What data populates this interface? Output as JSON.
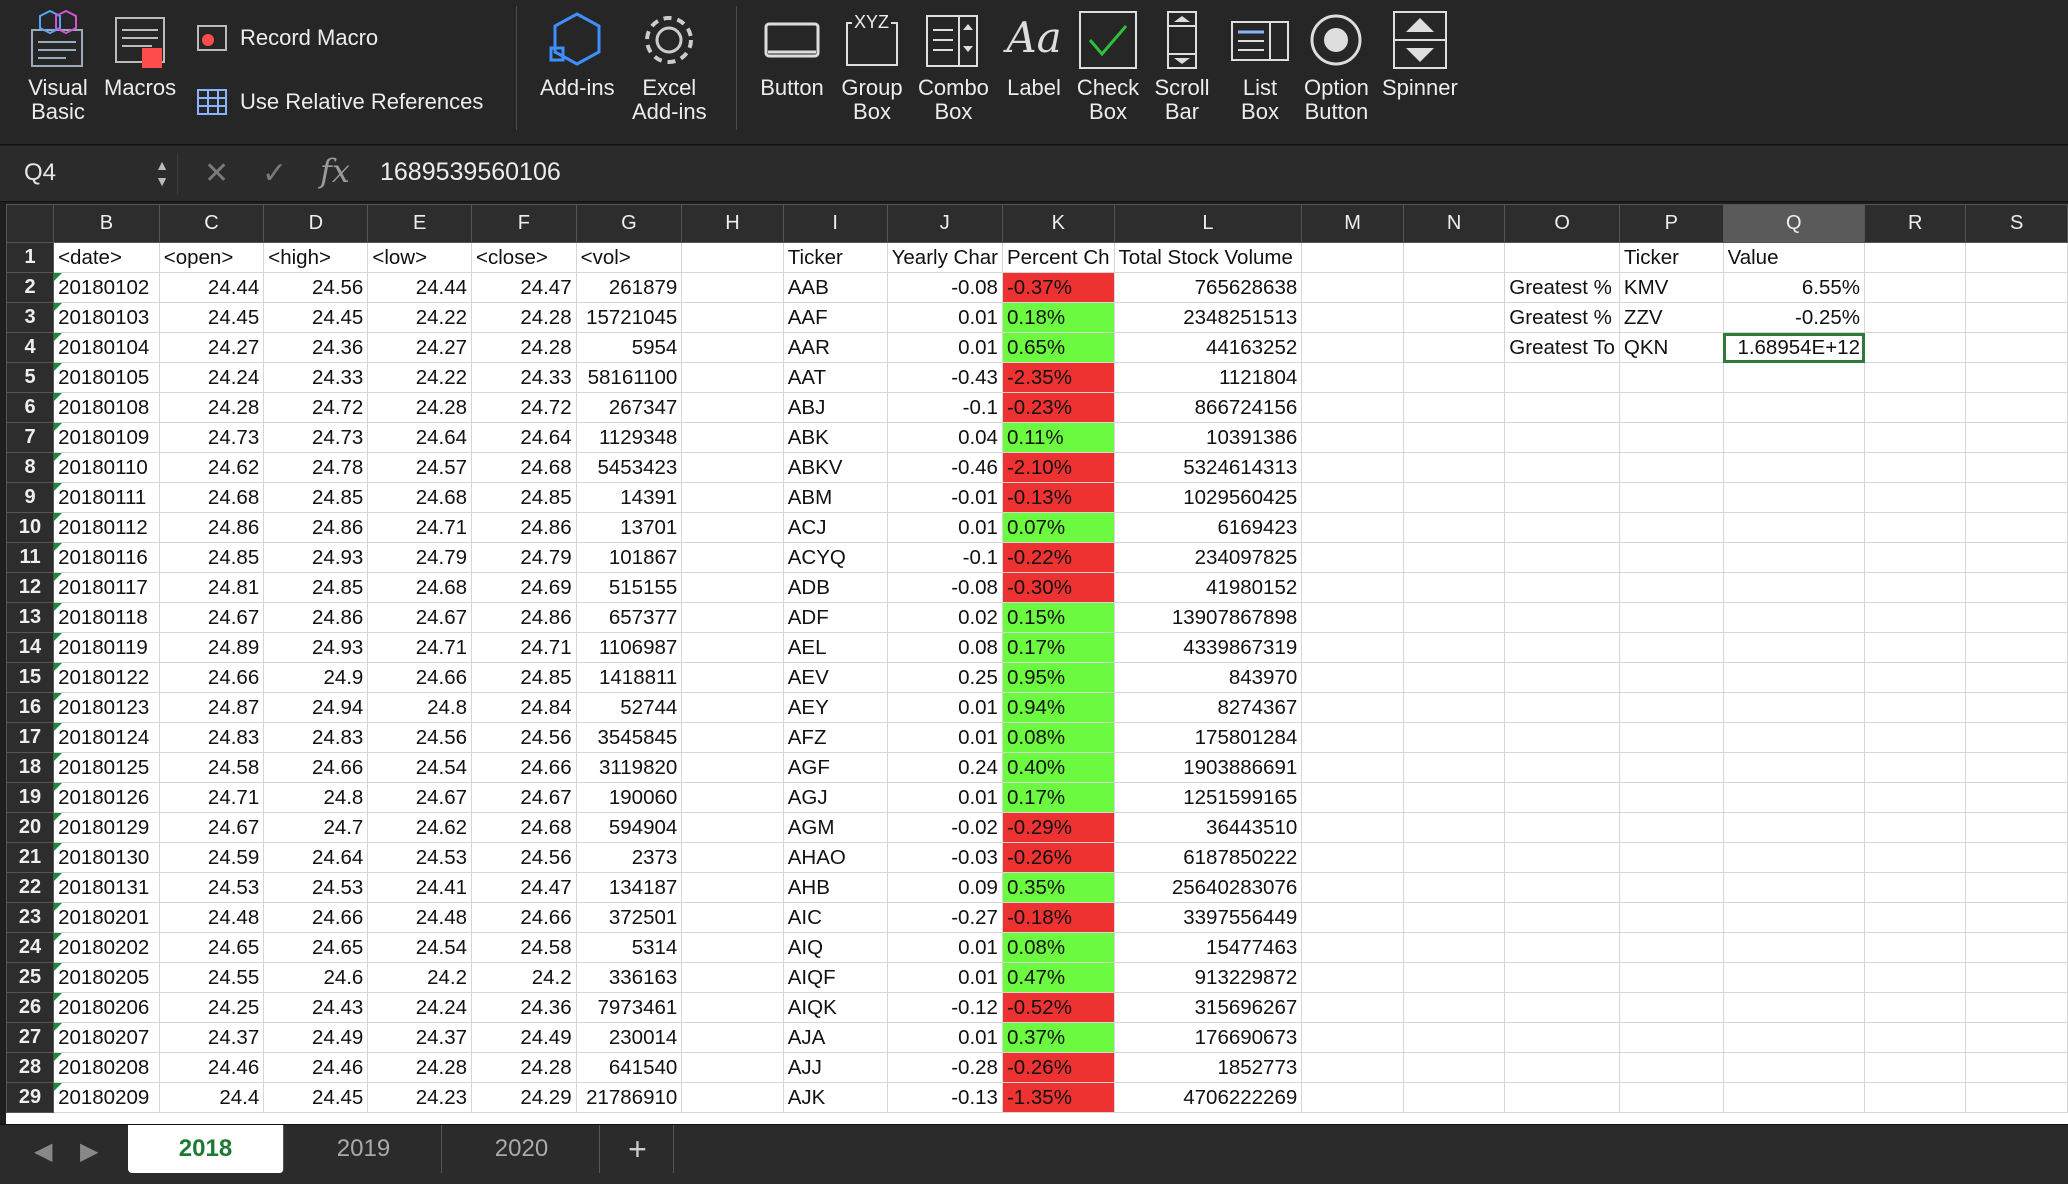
{
  "ribbon": {
    "visual_basic": "Visual\nBasic",
    "macros": "Macros",
    "record_macro": "Record Macro",
    "use_relative_references": "Use Relative References",
    "add_ins": "Add-ins",
    "excel_add_ins": "Excel\nAdd-ins",
    "button": "Button",
    "group_box": "Group\nBox",
    "combo_box": "Combo\nBox",
    "label": "Label",
    "check_box": "Check\nBox",
    "scroll_bar": "Scroll\nBar",
    "list_box": "List\nBox",
    "option_button": "Option\nButton",
    "spinner": "Spinner",
    "label_icon_text": "Aa",
    "group_box_icon_text": "XYZ"
  },
  "formula_bar": {
    "name_box": "Q4",
    "fx": "fx",
    "value": "1689539560106"
  },
  "columns": [
    "B",
    "C",
    "D",
    "E",
    "F",
    "G",
    "H",
    "I",
    "J",
    "K",
    "L",
    "M",
    "N",
    "O",
    "P",
    "Q",
    "R",
    "S"
  ],
  "header_row": [
    "<date>",
    "<open>",
    "<high>",
    "<low>",
    "<close>",
    "<vol>",
    "",
    "Ticker",
    "Yearly Char",
    "Percent Ch",
    "Total Stock Volume",
    "",
    "",
    "",
    "Ticker",
    "Value",
    "",
    ""
  ],
  "rows": [
    {
      "n": "2",
      "date": "20180102",
      "open": "24.44",
      "high": "24.56",
      "low": "24.44",
      "close": "24.47",
      "vol": "261879",
      "ticker": "AAB",
      "yc": "-0.08",
      "pct": "-0.37%",
      "tv": "765628638",
      "o": "Greatest %",
      "p": "KMV",
      "q": "6.55%"
    },
    {
      "n": "3",
      "date": "20180103",
      "open": "24.45",
      "high": "24.45",
      "low": "24.22",
      "close": "24.28",
      "vol": "15721045",
      "ticker": "AAF",
      "yc": "0.01",
      "pct": "0.18%",
      "tv": "2348251513",
      "o": "Greatest %",
      "p": "ZZV",
      "q": "-0.25%"
    },
    {
      "n": "4",
      "date": "20180104",
      "open": "24.27",
      "high": "24.36",
      "low": "24.27",
      "close": "24.28",
      "vol": "5954",
      "ticker": "AAR",
      "yc": "0.01",
      "pct": "0.65%",
      "tv": "44163252",
      "o": "Greatest To",
      "p": "QKN",
      "q": "1.68954E+12"
    },
    {
      "n": "5",
      "date": "20180105",
      "open": "24.24",
      "high": "24.33",
      "low": "24.22",
      "close": "24.33",
      "vol": "58161100",
      "ticker": "AAT",
      "yc": "-0.43",
      "pct": "-2.35%",
      "tv": "1121804",
      "o": "",
      "p": "",
      "q": ""
    },
    {
      "n": "6",
      "date": "20180108",
      "open": "24.28",
      "high": "24.72",
      "low": "24.28",
      "close": "24.72",
      "vol": "267347",
      "ticker": "ABJ",
      "yc": "-0.1",
      "pct": "-0.23%",
      "tv": "866724156",
      "o": "",
      "p": "",
      "q": ""
    },
    {
      "n": "7",
      "date": "20180109",
      "open": "24.73",
      "high": "24.73",
      "low": "24.64",
      "close": "24.64",
      "vol": "1129348",
      "ticker": "ABK",
      "yc": "0.04",
      "pct": "0.11%",
      "tv": "10391386",
      "o": "",
      "p": "",
      "q": ""
    },
    {
      "n": "8",
      "date": "20180110",
      "open": "24.62",
      "high": "24.78",
      "low": "24.57",
      "close": "24.68",
      "vol": "5453423",
      "ticker": "ABKV",
      "yc": "-0.46",
      "pct": "-2.10%",
      "tv": "5324614313",
      "o": "",
      "p": "",
      "q": ""
    },
    {
      "n": "9",
      "date": "20180111",
      "open": "24.68",
      "high": "24.85",
      "low": "24.68",
      "close": "24.85",
      "vol": "14391",
      "ticker": "ABM",
      "yc": "-0.01",
      "pct": "-0.13%",
      "tv": "1029560425",
      "o": "",
      "p": "",
      "q": ""
    },
    {
      "n": "10",
      "date": "20180112",
      "open": "24.86",
      "high": "24.86",
      "low": "24.71",
      "close": "24.86",
      "vol": "13701",
      "ticker": "ACJ",
      "yc": "0.01",
      "pct": "0.07%",
      "tv": "6169423",
      "o": "",
      "p": "",
      "q": ""
    },
    {
      "n": "11",
      "date": "20180116",
      "open": "24.85",
      "high": "24.93",
      "low": "24.79",
      "close": "24.79",
      "vol": "101867",
      "ticker": "ACYQ",
      "yc": "-0.1",
      "pct": "-0.22%",
      "tv": "234097825",
      "o": "",
      "p": "",
      "q": ""
    },
    {
      "n": "12",
      "date": "20180117",
      "open": "24.81",
      "high": "24.85",
      "low": "24.68",
      "close": "24.69",
      "vol": "515155",
      "ticker": "ADB",
      "yc": "-0.08",
      "pct": "-0.30%",
      "tv": "41980152",
      "o": "",
      "p": "",
      "q": ""
    },
    {
      "n": "13",
      "date": "20180118",
      "open": "24.67",
      "high": "24.86",
      "low": "24.67",
      "close": "24.86",
      "vol": "657377",
      "ticker": "ADF",
      "yc": "0.02",
      "pct": "0.15%",
      "tv": "13907867898",
      "o": "",
      "p": "",
      "q": ""
    },
    {
      "n": "14",
      "date": "20180119",
      "open": "24.89",
      "high": "24.93",
      "low": "24.71",
      "close": "24.71",
      "vol": "1106987",
      "ticker": "AEL",
      "yc": "0.08",
      "pct": "0.17%",
      "tv": "4339867319",
      "o": "",
      "p": "",
      "q": ""
    },
    {
      "n": "15",
      "date": "20180122",
      "open": "24.66",
      "high": "24.9",
      "low": "24.66",
      "close": "24.85",
      "vol": "1418811",
      "ticker": "AEV",
      "yc": "0.25",
      "pct": "0.95%",
      "tv": "843970",
      "o": "",
      "p": "",
      "q": ""
    },
    {
      "n": "16",
      "date": "20180123",
      "open": "24.87",
      "high": "24.94",
      "low": "24.8",
      "close": "24.84",
      "vol": "52744",
      "ticker": "AEY",
      "yc": "0.01",
      "pct": "0.94%",
      "tv": "8274367",
      "o": "",
      "p": "",
      "q": ""
    },
    {
      "n": "17",
      "date": "20180124",
      "open": "24.83",
      "high": "24.83",
      "low": "24.56",
      "close": "24.56",
      "vol": "3545845",
      "ticker": "AFZ",
      "yc": "0.01",
      "pct": "0.08%",
      "tv": "175801284",
      "o": "",
      "p": "",
      "q": ""
    },
    {
      "n": "18",
      "date": "20180125",
      "open": "24.58",
      "high": "24.66",
      "low": "24.54",
      "close": "24.66",
      "vol": "3119820",
      "ticker": "AGF",
      "yc": "0.24",
      "pct": "0.40%",
      "tv": "1903886691",
      "o": "",
      "p": "",
      "q": ""
    },
    {
      "n": "19",
      "date": "20180126",
      "open": "24.71",
      "high": "24.8",
      "low": "24.67",
      "close": "24.67",
      "vol": "190060",
      "ticker": "AGJ",
      "yc": "0.01",
      "pct": "0.17%",
      "tv": "1251599165",
      "o": "",
      "p": "",
      "q": ""
    },
    {
      "n": "20",
      "date": "20180129",
      "open": "24.67",
      "high": "24.7",
      "low": "24.62",
      "close": "24.68",
      "vol": "594904",
      "ticker": "AGM",
      "yc": "-0.02",
      "pct": "-0.29%",
      "tv": "36443510",
      "o": "",
      "p": "",
      "q": ""
    },
    {
      "n": "21",
      "date": "20180130",
      "open": "24.59",
      "high": "24.64",
      "low": "24.53",
      "close": "24.56",
      "vol": "2373",
      "ticker": "AHAO",
      "yc": "-0.03",
      "pct": "-0.26%",
      "tv": "6187850222",
      "o": "",
      "p": "",
      "q": ""
    },
    {
      "n": "22",
      "date": "20180131",
      "open": "24.53",
      "high": "24.53",
      "low": "24.41",
      "close": "24.47",
      "vol": "134187",
      "ticker": "AHB",
      "yc": "0.09",
      "pct": "0.35%",
      "tv": "25640283076",
      "o": "",
      "p": "",
      "q": ""
    },
    {
      "n": "23",
      "date": "20180201",
      "open": "24.48",
      "high": "24.66",
      "low": "24.48",
      "close": "24.66",
      "vol": "372501",
      "ticker": "AIC",
      "yc": "-0.27",
      "pct": "-0.18%",
      "tv": "3397556449",
      "o": "",
      "p": "",
      "q": ""
    },
    {
      "n": "24",
      "date": "20180202",
      "open": "24.65",
      "high": "24.65",
      "low": "24.54",
      "close": "24.58",
      "vol": "5314",
      "ticker": "AIQ",
      "yc": "0.01",
      "pct": "0.08%",
      "tv": "15477463",
      "o": "",
      "p": "",
      "q": ""
    },
    {
      "n": "25",
      "date": "20180205",
      "open": "24.55",
      "high": "24.6",
      "low": "24.2",
      "close": "24.2",
      "vol": "336163",
      "ticker": "AIQF",
      "yc": "0.01",
      "pct": "0.47%",
      "tv": "913229872",
      "o": "",
      "p": "",
      "q": ""
    },
    {
      "n": "26",
      "date": "20180206",
      "open": "24.25",
      "high": "24.43",
      "low": "24.24",
      "close": "24.36",
      "vol": "7973461",
      "ticker": "AIQK",
      "yc": "-0.12",
      "pct": "-0.52%",
      "tv": "315696267",
      "o": "",
      "p": "",
      "q": ""
    },
    {
      "n": "27",
      "date": "20180207",
      "open": "24.37",
      "high": "24.49",
      "low": "24.37",
      "close": "24.49",
      "vol": "230014",
      "ticker": "AJA",
      "yc": "0.01",
      "pct": "0.37%",
      "tv": "176690673",
      "o": "",
      "p": "",
      "q": ""
    },
    {
      "n": "28",
      "date": "20180208",
      "open": "24.46",
      "high": "24.46",
      "low": "24.28",
      "close": "24.28",
      "vol": "641540",
      "ticker": "AJJ",
      "yc": "-0.28",
      "pct": "-0.26%",
      "tv": "1852773",
      "o": "",
      "p": "",
      "q": ""
    },
    {
      "n": "29",
      "date": "20180209",
      "open": "24.4",
      "high": "24.45",
      "low": "24.23",
      "close": "24.29",
      "vol": "21786910",
      "ticker": "AJK",
      "yc": "-0.13",
      "pct": "-1.35%",
      "tv": "4706222269",
      "o": "",
      "p": "",
      "q": ""
    }
  ],
  "sheet_tabs": [
    "2018",
    "2019",
    "2020"
  ],
  "add_sheet": "+",
  "colors": {
    "positive": "#6bfa3f",
    "negative": "#ee3131",
    "accent": "#1d7a35"
  }
}
